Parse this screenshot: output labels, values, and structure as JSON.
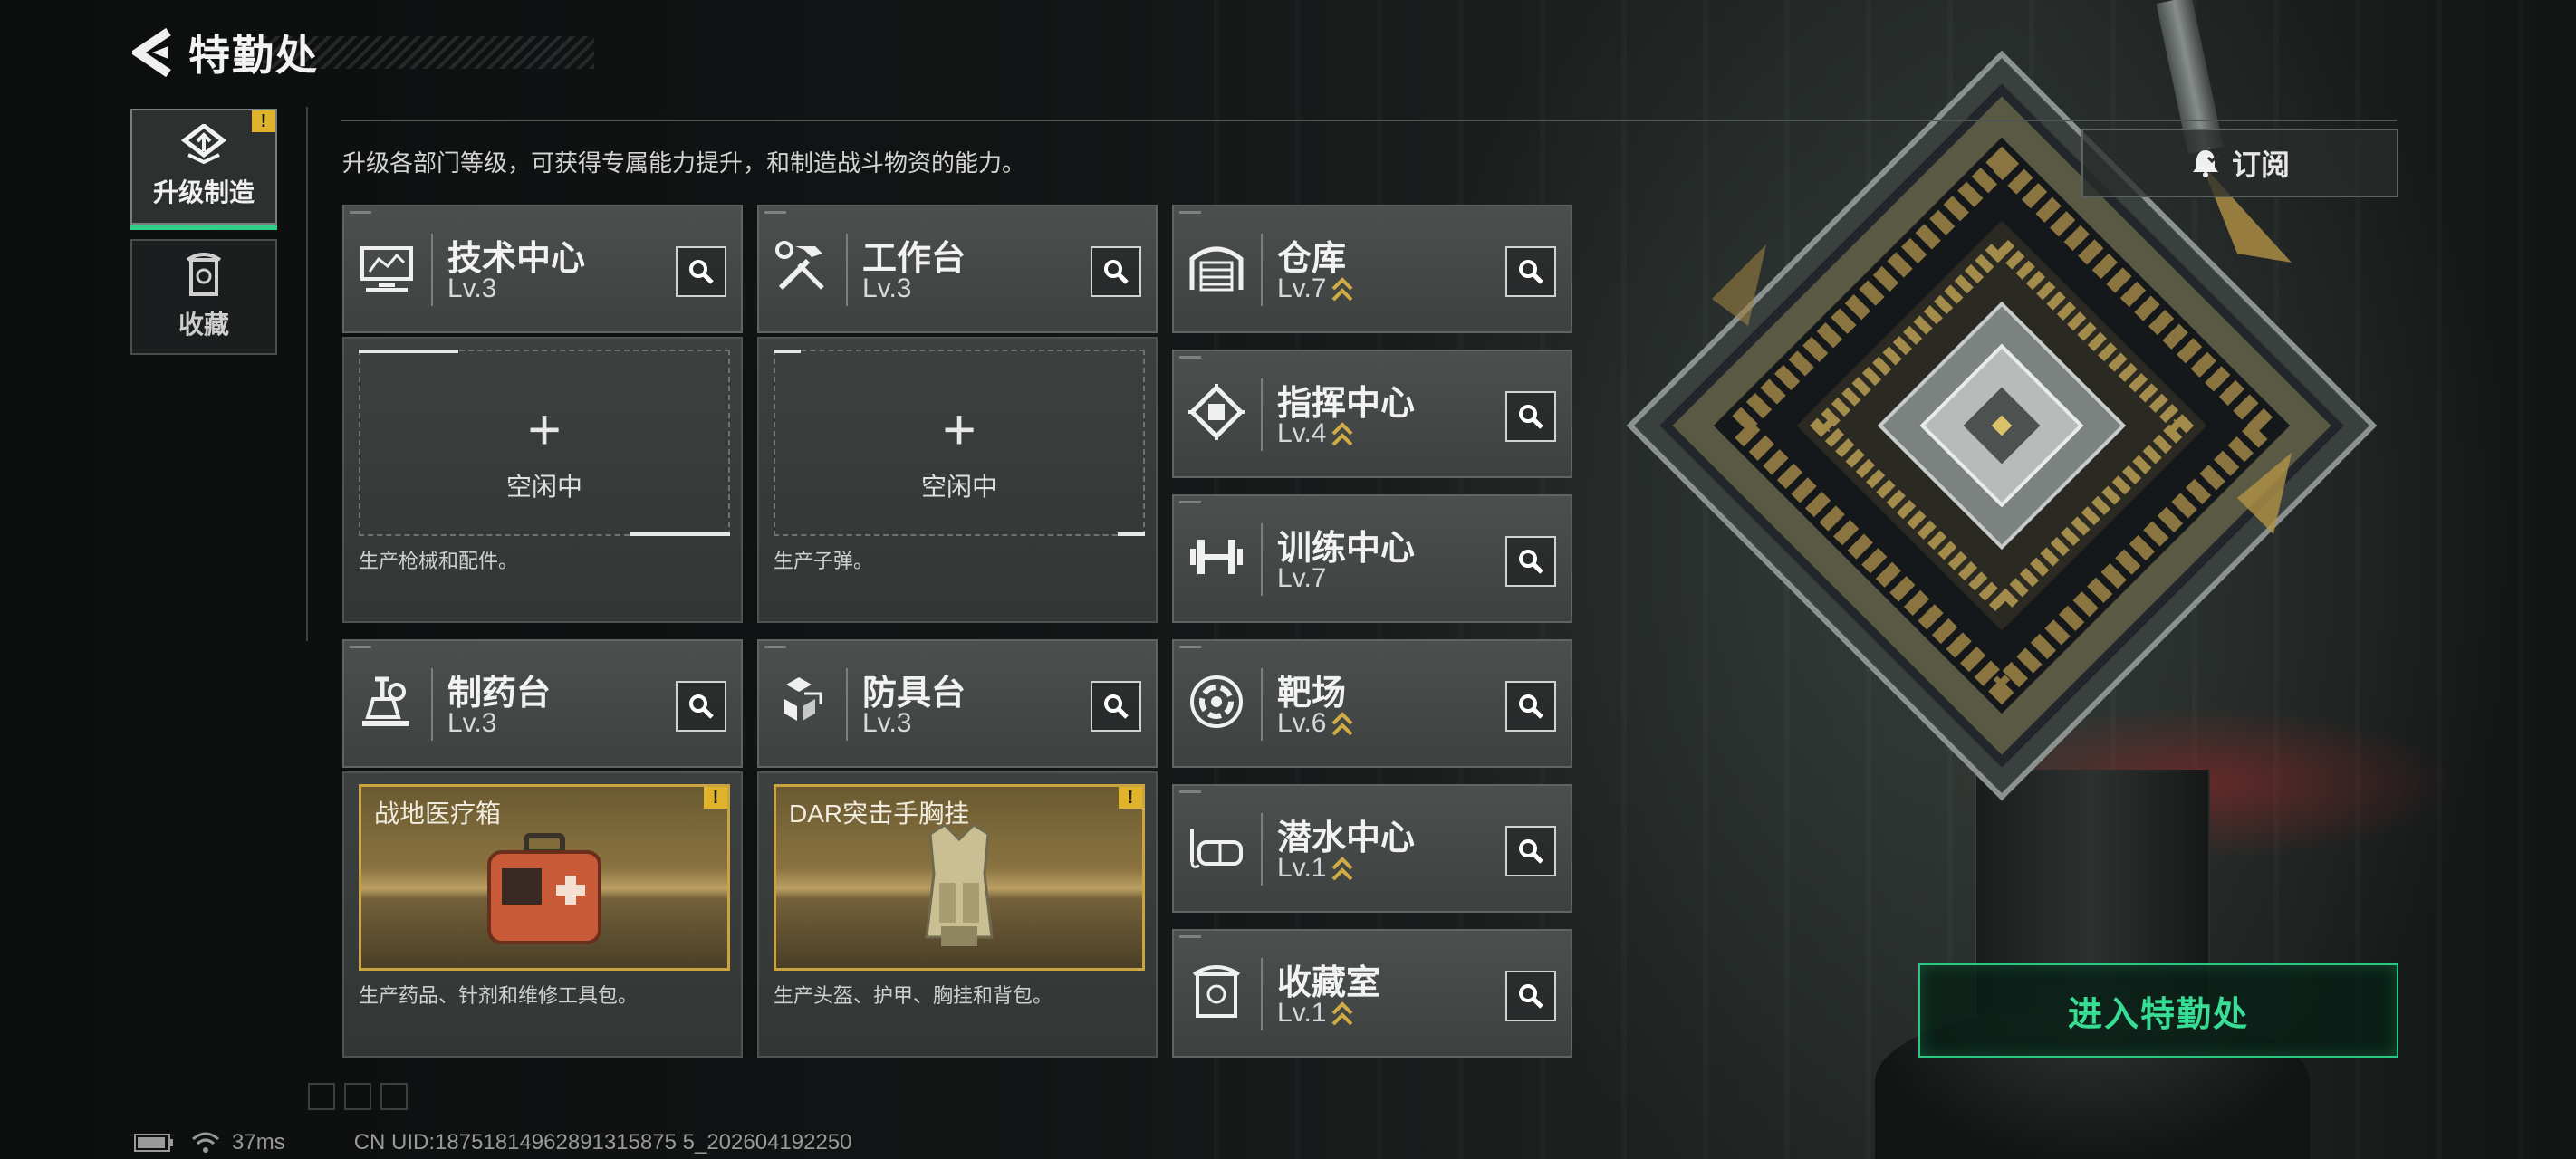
{
  "header": {
    "title": "特勤处"
  },
  "nav": [
    {
      "label": "升级制造",
      "icon": "upgrade-icon",
      "active": true,
      "alert": "!"
    },
    {
      "label": "收藏",
      "icon": "collection-icon",
      "active": false
    }
  ],
  "description": "升级各部门等级，可获得专属能力提升，和制造战斗物资的能力。",
  "subscribe": {
    "label": "订阅",
    "icon": "bell-icon"
  },
  "departments": [
    {
      "name": "技术中心",
      "level": "Lv.3",
      "icon": "tech-center-icon",
      "upgradable": false
    },
    {
      "name": "工作台",
      "level": "Lv.3",
      "icon": "workbench-icon",
      "upgradable": false
    },
    {
      "name": "制药台",
      "level": "Lv.3",
      "icon": "pharmacy-icon",
      "upgradable": false
    },
    {
      "name": "防具台",
      "level": "Lv.3",
      "icon": "armor-bench-icon",
      "upgradable": false
    },
    {
      "name": "仓库",
      "level": "Lv.7",
      "icon": "warehouse-icon",
      "upgradable": true
    },
    {
      "name": "指挥中心",
      "level": "Lv.4",
      "icon": "command-center-icon",
      "upgradable": true
    },
    {
      "name": "训练中心",
      "level": "Lv.7",
      "icon": "training-center-icon",
      "upgradable": false
    },
    {
      "name": "靶场",
      "level": "Lv.6",
      "icon": "shooting-range-icon",
      "upgradable": true
    },
    {
      "name": "潜水中心",
      "level": "Lv.1",
      "icon": "diving-center-icon",
      "upgradable": true
    },
    {
      "name": "收藏室",
      "level": "Lv.1",
      "icon": "collection-room-icon",
      "upgradable": true
    }
  ],
  "production": [
    {
      "status": "空闲中",
      "description": "生产枪械和配件。"
    },
    {
      "status": "空闲中",
      "description": "生产子弹。"
    },
    {
      "item": "战地医疗箱",
      "alert": "!",
      "description": "生产药品、针剂和维修工具包。"
    },
    {
      "item": "DAR突击手胸挂",
      "alert": "!",
      "description": "生产头盔、护甲、胸挂和背包。"
    }
  ],
  "enter_button": {
    "label": "进入特勤处"
  },
  "status_bar": {
    "ping": "37ms",
    "uid": "CN UID:18751814962891315875 5_202604192250"
  },
  "colors": {
    "accent_green": "#2fd08a",
    "alert_yellow": "#e0b42a",
    "upgrade_gold": "#c9a440"
  }
}
